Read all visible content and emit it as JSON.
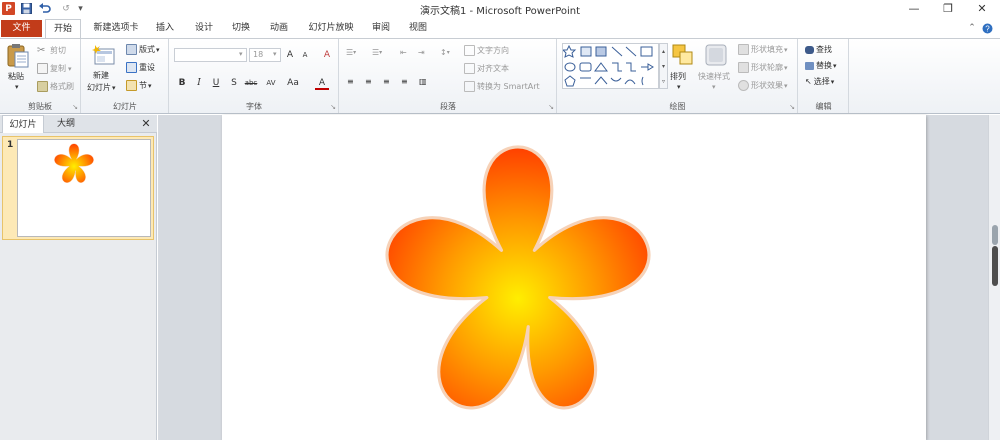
{
  "window": {
    "title": "演示文稿1 - Microsoft PowerPoint",
    "app_icon_letter": "P",
    "qat": {
      "redo": "↺",
      "customize": "▾"
    },
    "controls": {
      "minimize": "—",
      "restore": "❐",
      "close": "✕"
    }
  },
  "tabs": [
    {
      "label": "文件",
      "file": true
    },
    {
      "label": "开始",
      "active": true
    },
    {
      "label": "新建选项卡"
    },
    {
      "label": "插入"
    },
    {
      "label": "设计"
    },
    {
      "label": "切换"
    },
    {
      "label": "动画"
    },
    {
      "label": "幻灯片放映"
    },
    {
      "label": "审阅"
    },
    {
      "label": "视图"
    }
  ],
  "ribbon": {
    "clipboard": {
      "paste": "粘贴",
      "paste_arrow": "▾",
      "cut": "剪切",
      "copy": "复制",
      "copy_arrow": "▾",
      "format_painter": "格式刷",
      "group_label": "剪贴板"
    },
    "slides": {
      "new_slide_line1": "新建",
      "new_slide_line2": "幻灯片",
      "layout": "版式",
      "reset": "重设",
      "section": "节",
      "group_label": "幻灯片"
    },
    "font": {
      "font_name": "",
      "font_size": "18",
      "grow": "A",
      "shrink": "A",
      "clear": "A",
      "bold": "B",
      "italic": "I",
      "underline": "U",
      "shadow": "S",
      "strike": "abc",
      "spacing": "AV",
      "case": "Aa",
      "color": "A",
      "group_label": "字体"
    },
    "paragraph": {
      "text_direction": "文字方向",
      "align_text": "对齐文本",
      "convert_smartart": "转换为 SmartArt",
      "group_label": "段落"
    },
    "drawing": {
      "arrange": "排列",
      "quick_styles": "快速样式",
      "shape_fill": "形状填充",
      "shape_outline": "形状轮廓",
      "shape_effects": "形状效果",
      "group_label": "绘图"
    },
    "editing": {
      "find": "查找",
      "replace": "替换",
      "select": "选择",
      "group_label": "编辑"
    }
  },
  "left_pane": {
    "tabs": [
      "幻灯片",
      "大纲"
    ],
    "close": "✕",
    "slide_number": "1"
  },
  "colors": {
    "accent": "#c23c1a",
    "flower_center": "#ffee00",
    "flower_mid": "#ff9a00",
    "flower_edge": "#ff2a00",
    "flower_outline": "#f6d2b8"
  }
}
